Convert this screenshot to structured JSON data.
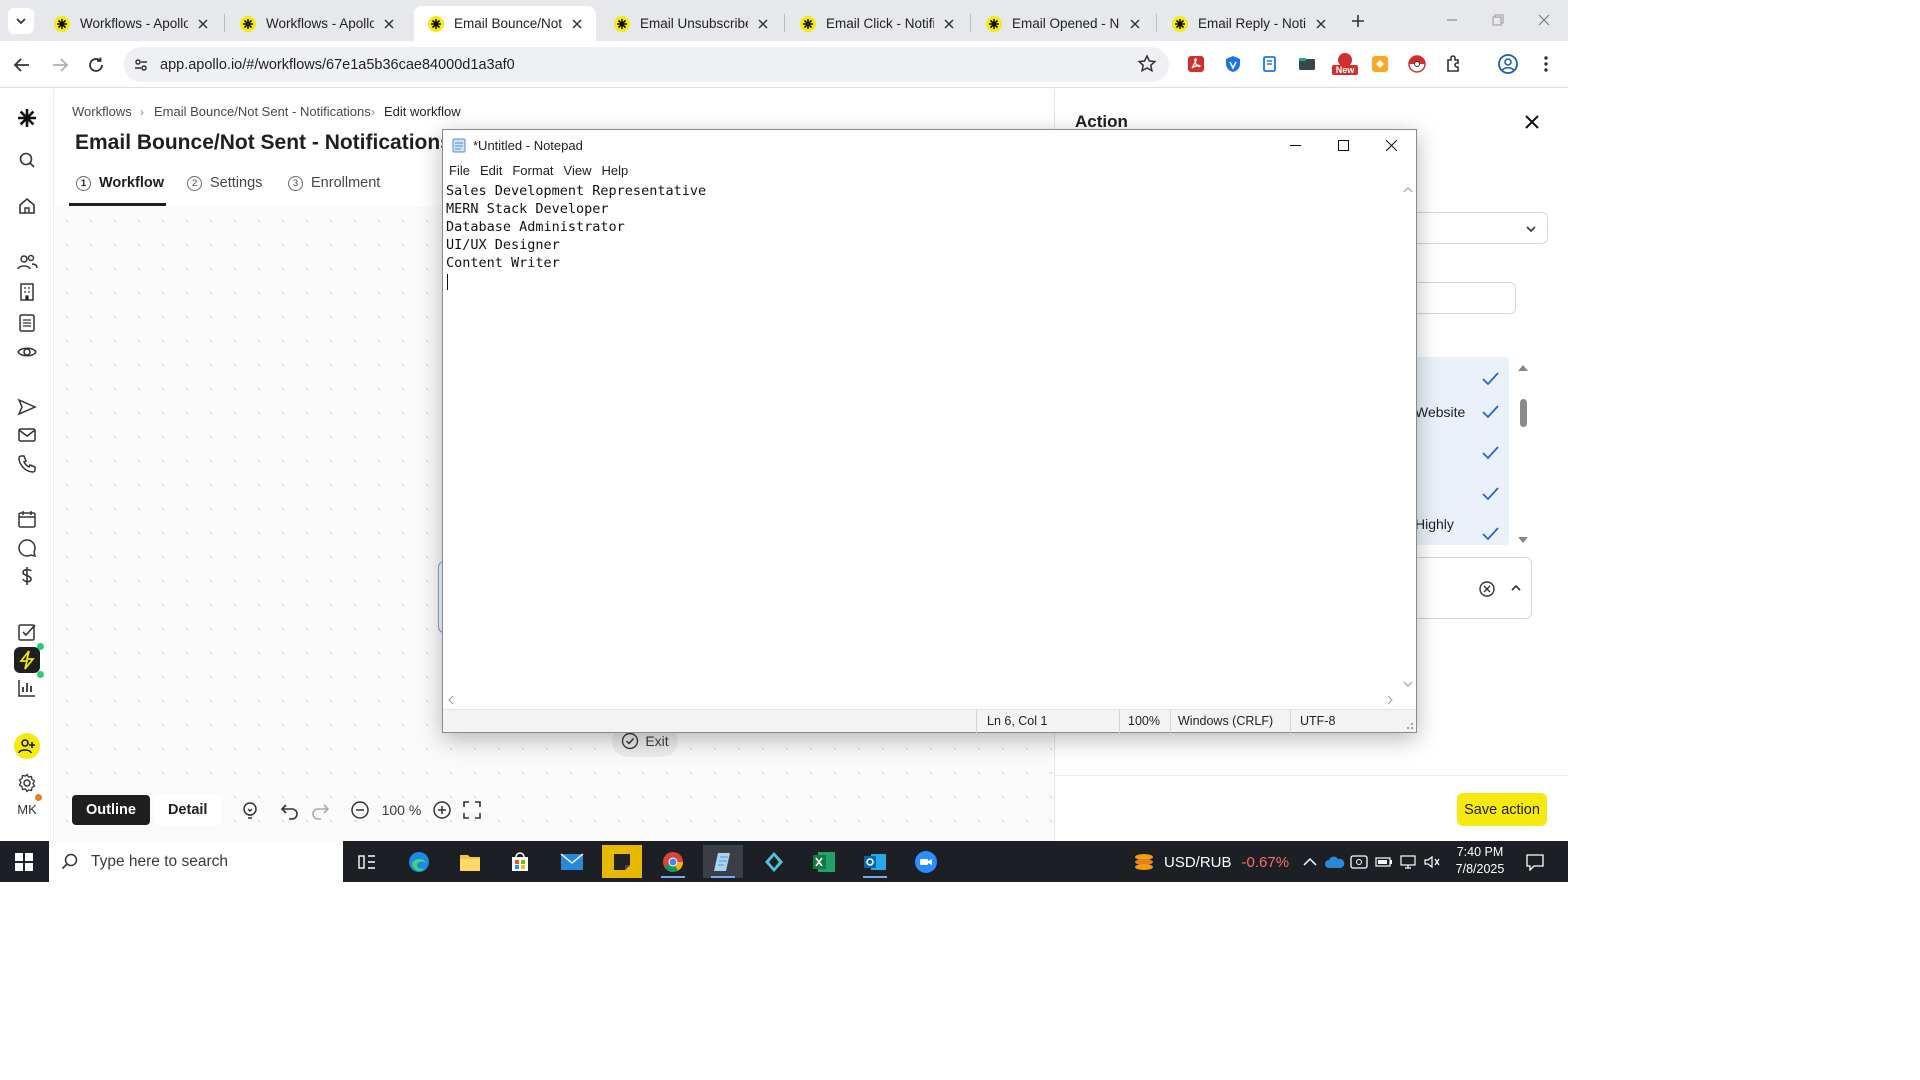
{
  "browser": {
    "tabs": [
      {
        "label": "Workflows - Apollo",
        "active": false
      },
      {
        "label": "Workflows - Apollo",
        "active": false
      },
      {
        "label": "Email Bounce/Not Se",
        "active": true
      },
      {
        "label": "Email Unsubscribe - I",
        "active": false
      },
      {
        "label": "Email Click - Notifica",
        "active": false
      },
      {
        "label": "Email Opened - Notifi",
        "active": false
      },
      {
        "label": "Email Reply - Notifica",
        "active": false
      }
    ],
    "url": "app.apollo.io/#/workflows/67e1a5b36cae84000d1a3af0",
    "ext_badge": "New",
    "colors": {
      "apollo_favicon": "#f5e90f",
      "accent": "#1a73e8"
    }
  },
  "app": {
    "nav_icons": [
      "apollo-logo-icon",
      "search-icon",
      "home-icon",
      "people-icon",
      "companies-icon",
      "lists-icon",
      "tracking-icon",
      "sequences-icon",
      "email-icon",
      "phone-icon",
      "calendar-icon",
      "chat-icon",
      "deals-icon",
      "tasks-icon",
      "workflows-icon",
      "analytics-icon",
      "add-user-icon",
      "settings-icon"
    ],
    "avatar_initials": "MK",
    "breadcrumb": [
      "Workflows",
      "Email Bounce/Not Sent - Notifications",
      "Edit workflow"
    ],
    "title": "Email Bounce/Not Sent - Notifications",
    "tabs": [
      {
        "num": "1",
        "label": "Workflow"
      },
      {
        "num": "2",
        "label": "Settings"
      },
      {
        "num": "3",
        "label": "Enrollment"
      }
    ],
    "exit_label": "Exit",
    "view_toggle": {
      "outline": "Outline",
      "detail": "Detail"
    },
    "zoom": "100 %",
    "right_panel": {
      "title": "Action",
      "options": [
        "Website",
        "Highly"
      ],
      "save_label": "Save action"
    }
  },
  "notepad": {
    "title": "*Untitled - Notepad",
    "menu": [
      "File",
      "Edit",
      "Format",
      "View",
      "Help"
    ],
    "lines": [
      "Sales Development Representative",
      "MERN Stack Developer",
      "Database Administrator",
      "UI/UX Designer",
      "Content Writer"
    ],
    "status": {
      "position": "Ln 6, Col 1",
      "zoom": "100%",
      "line_ending": "Windows (CRLF)",
      "encoding": "UTF-8"
    }
  },
  "taskbar": {
    "search_placeholder": "Type here to search",
    "ticker_label": "USD/RUB",
    "ticker_change": "-0.67%",
    "time": "7:40 PM",
    "date": "7/8/2025"
  }
}
